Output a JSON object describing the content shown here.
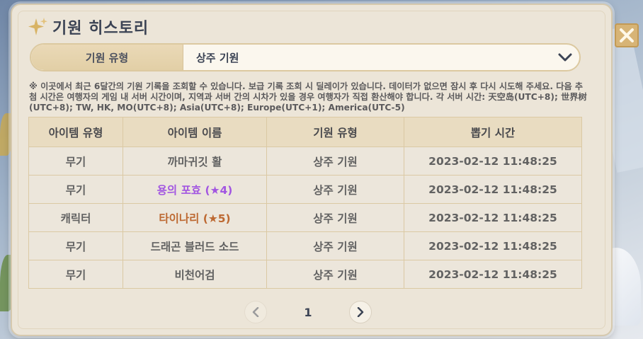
{
  "window": {
    "title": "기원 히스토리"
  },
  "selector": {
    "label": "기원 유형",
    "value": "상주 기원"
  },
  "notice": "※ 이곳에서 최근 6달간의 기원 기록을 조회할 수 있습니다. 보급 기록 조회 시 딜레이가 있습니다. 데이터가 없으면 잠시 후 다시 시도해 주세요. 다음 추첨 시간은 여행자의 게임 내 서버 시간이며, 지역과 서버 간의 시차가 있을 경우 여행자가 직접 환산해야 합니다. 각 서버 시간: 天空岛(UTC+8); 世界树(UTC+8); TW, HK, MO(UTC+8); Asia(UTC+8); Europe(UTC+1); America(UTC-5)",
  "table": {
    "headers": [
      "아이템 유형",
      "아이템 이름",
      "기원 유형",
      "뽑기 시간"
    ],
    "rows": [
      {
        "type": "무기",
        "name": "까마귀깃 활",
        "banner": "상주 기원",
        "time": "2023-02-12 11:48:25",
        "rarity": 3
      },
      {
        "type": "무기",
        "name": "용의 포효 (★4)",
        "banner": "상주 기원",
        "time": "2023-02-12 11:48:25",
        "rarity": 4
      },
      {
        "type": "캐릭터",
        "name": "타이나리 (★5)",
        "banner": "상주 기원",
        "time": "2023-02-12 11:48:25",
        "rarity": 5
      },
      {
        "type": "무기",
        "name": "드래곤 블러드 소드",
        "banner": "상주 기원",
        "time": "2023-02-12 11:48:25",
        "rarity": 3
      },
      {
        "type": "무기",
        "name": "비천어검",
        "banner": "상주 기원",
        "time": "2023-02-12 11:48:25",
        "rarity": 3
      }
    ]
  },
  "pagination": {
    "current_page": "1",
    "prev_icon": "chevron-left-icon",
    "next_icon": "chevron-right-icon"
  },
  "colors": {
    "rarity4": "#a256e1",
    "rarity5": "#bd6932",
    "panel": "#ece5d8",
    "accent_gold": "#d7b476"
  }
}
